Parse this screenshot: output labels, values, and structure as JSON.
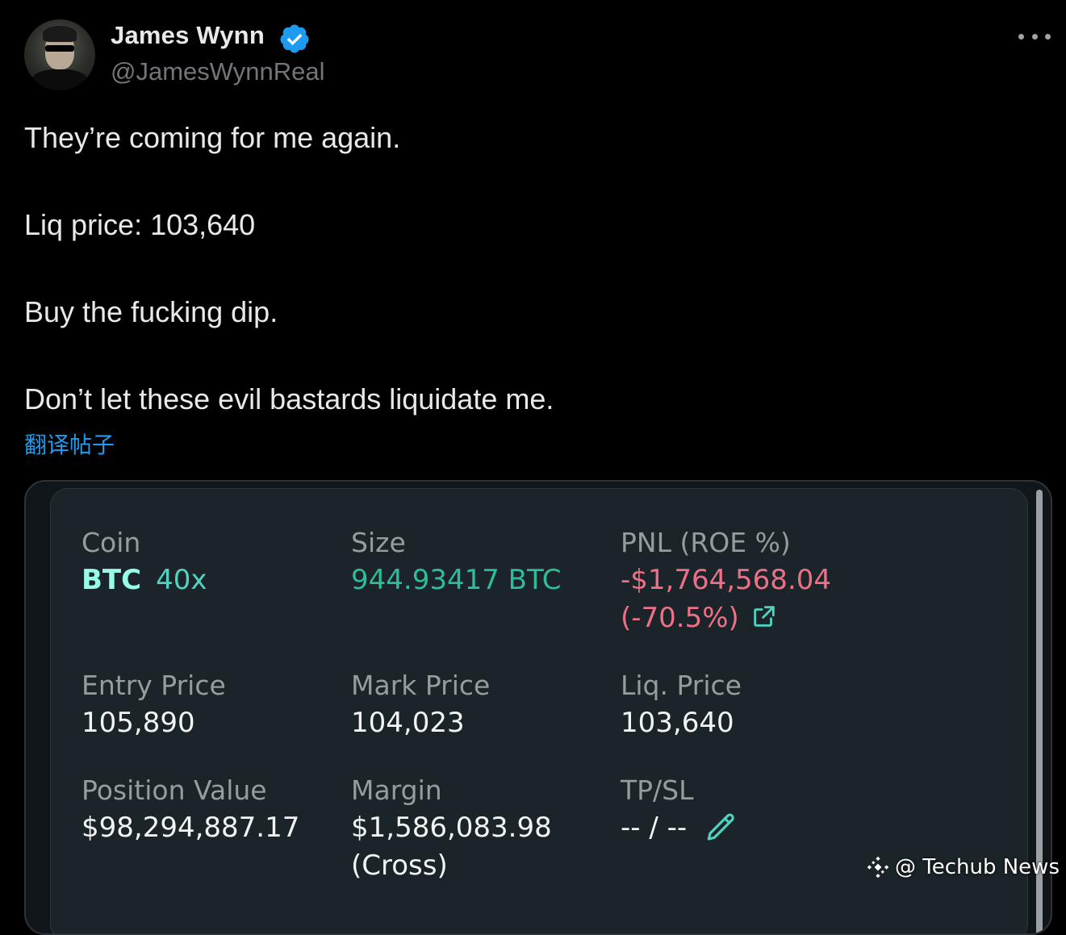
{
  "author": {
    "display_name": "James Wynn",
    "handle": "@JamesWynnReal",
    "verified_icon": "verified-badge-icon",
    "verified_color": "#1d9bf0"
  },
  "tweet": {
    "lines": [
      "They’re coming for me again.",
      "Liq price: 103,640",
      "Buy the fucking dip.",
      "Don’t let these evil bastards liquidate me."
    ],
    "translate_label": "翻译帖子"
  },
  "position_card": {
    "coin": {
      "label": "Coin",
      "symbol": "BTC",
      "leverage": "40x"
    },
    "size": {
      "label": "Size",
      "value": "944.93417 BTC"
    },
    "pnl": {
      "label": "PNL (ROE %)",
      "value": "-$1,764,568.04",
      "roe": "(-70.5%)"
    },
    "entry_price": {
      "label": "Entry Price",
      "value": "105,890"
    },
    "mark_price": {
      "label": "Mark Price",
      "value": "104,023"
    },
    "liq_price": {
      "label": "Liq. Price",
      "value": "103,640"
    },
    "position_value": {
      "label": "Position Value",
      "value": "$98,294,887.17"
    },
    "margin": {
      "label": "Margin",
      "value": "$1,586,083.98",
      "mode": "(Cross)"
    },
    "tp_sl": {
      "label": "TP/SL",
      "value": "-- / --"
    }
  },
  "watermark": {
    "text": "@ Techub News"
  },
  "colors": {
    "background": "#000000",
    "link": "#1d9bf0",
    "positive": "#50d2c1",
    "negative": "#ed7088",
    "card_bg": "#1b2429"
  }
}
